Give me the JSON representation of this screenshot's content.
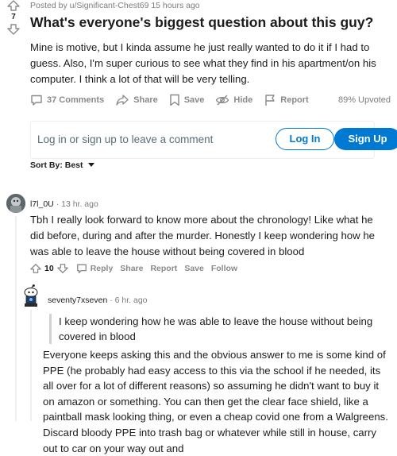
{
  "post": {
    "score": "7",
    "posted_by": "Posted by u/Significant-Chest69 15 hours ago",
    "title": "What's everyone's biggest question about this guy?",
    "body": "Mine is motive, but I kinda assume he just really wanted to do it if I had to guess. Also, I'm super curious to see what they find in his apartment/on his computer. I think a lot of that will be very telling.",
    "actions": {
      "comments": "37 Comments",
      "share": "Share",
      "save": "Save",
      "hide": "Hide",
      "report": "Report"
    },
    "upvoted": "89% Upvoted"
  },
  "login": {
    "prompt": "Log in or sign up to leave a comment",
    "login_label": "Log In",
    "signup_label": "Sign Up"
  },
  "sort": {
    "label": "Sort By: Best"
  },
  "comments": [
    {
      "username": "l7l_0U",
      "time": "· 13 hr. ago",
      "body": "Tbh I really look forward to know more about the chronology! Like what he did before, during and after the murder. Honestly I keep wondering how he was able to leave the house without being covered in blood",
      "score": "10",
      "actions": [
        "Reply",
        "Share",
        "Report",
        "Save",
        "Follow"
      ]
    },
    {
      "username": "seventy7xseven",
      "time": "· 6 hr. ago",
      "quote": "I keep wondering how he was able to leave the house without being covered in blood",
      "body": "Everyone keeps asking this and the obvious answer to me is some kind of PPE (he probably had easy access to this via the school if he needed, its all over for a lot of different reasons) so assuming he didn't want to buy it on amazon or something. You can then get the clear face shield, like a paintball mask looking thing, or even a cheap covid one from a Walgreens. Discard bloody PPE into trash bag or whatever while still in house, carry out to car on your way out and"
    }
  ],
  "colors": {
    "brand_blue": "#0079d3",
    "muted_text": "#7c7c7c",
    "action_gray": "#878a8c"
  }
}
